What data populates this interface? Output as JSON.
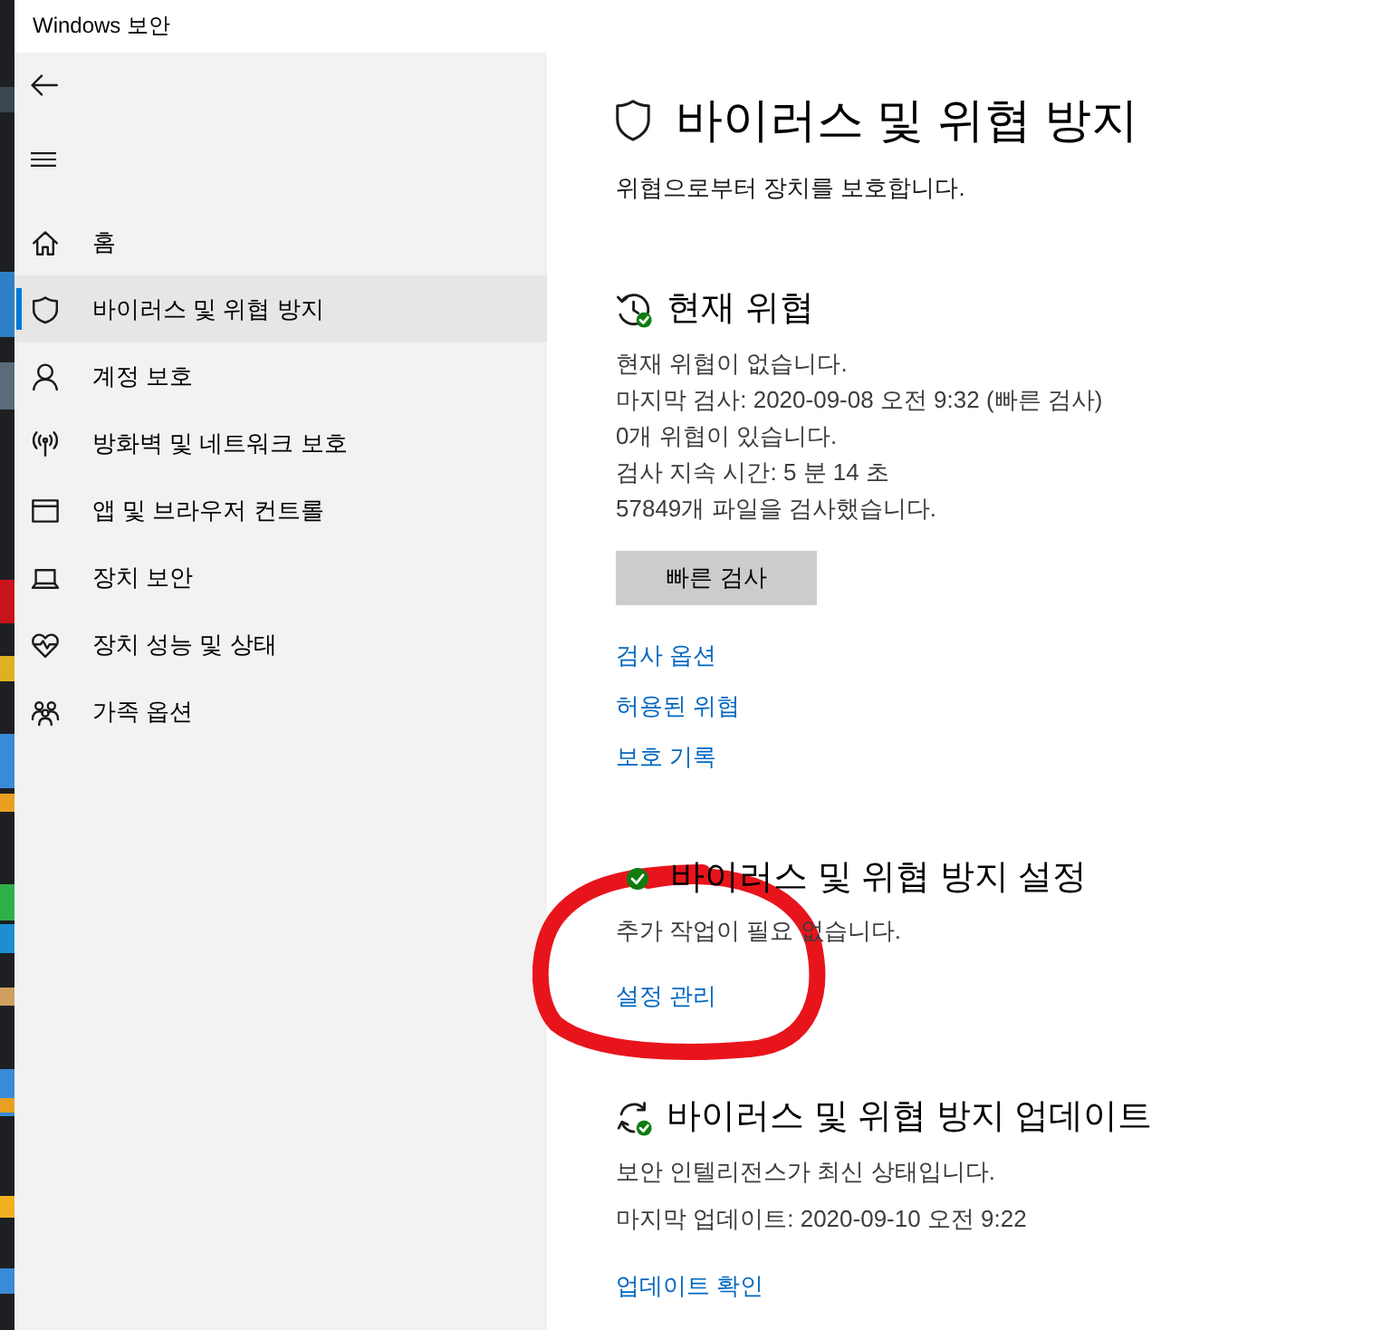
{
  "window": {
    "title": "Windows 보안"
  },
  "sidebar": {
    "items": [
      {
        "label": "홈",
        "selected": false
      },
      {
        "label": "바이러스 및 위협 방지",
        "selected": true
      },
      {
        "label": "계정 보호",
        "selected": false
      },
      {
        "label": "방화벽 및 네트워크 보호",
        "selected": false
      },
      {
        "label": "앱 및 브라우저 컨트롤",
        "selected": false
      },
      {
        "label": "장치 보안",
        "selected": false
      },
      {
        "label": "장치 성능 및 상태",
        "selected": false
      },
      {
        "label": "가족 옵션",
        "selected": false
      }
    ]
  },
  "page": {
    "title": "바이러스 및 위협 방지",
    "subtitle": "위협으로부터 장치를 보호합니다."
  },
  "sections": [
    {
      "heading": "현재 위협",
      "lines": [
        "현재 위협이 없습니다.",
        "마지막 검사: 2020-09-08 오전 9:32 (빠른 검사)",
        "0개 위협이 있습니다.",
        "검사 지속 시간: 5 분 14 초",
        "57849개 파일을 검사했습니다."
      ],
      "button": {
        "label": "빠른 검사"
      },
      "links": [
        "검사 옵션",
        "허용된 위협",
        "보호 기록"
      ]
    },
    {
      "heading": "바이러스 및 위협 방지 설정",
      "lines": [
        "추가 작업이 필요 없습니다."
      ],
      "links": [
        "설정 관리"
      ]
    },
    {
      "heading": "바이러스 및 위협 방지 업데이트",
      "lines": [
        "보안 인텔리전스가 최신 상태입니다.",
        "마지막 업데이트: 2020-09-10 오전 9:22"
      ],
      "links": [
        "업데이트 확인"
      ]
    }
  ],
  "annotation": {
    "kind": "circle"
  }
}
